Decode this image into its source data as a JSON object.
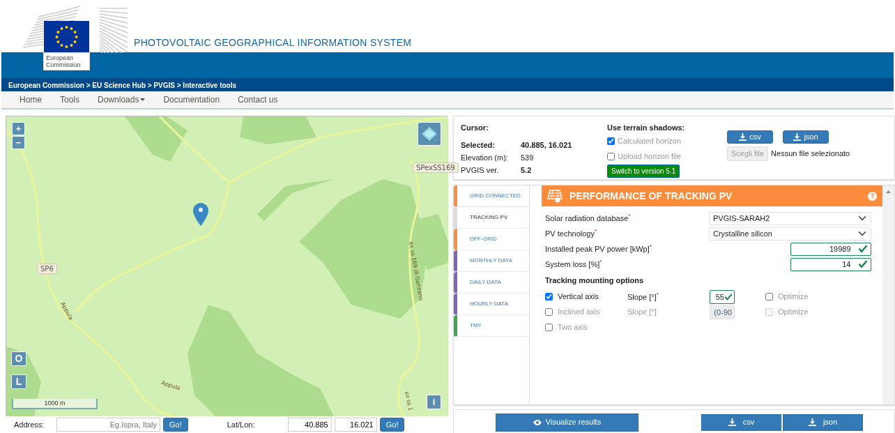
{
  "header": {
    "logo_lines": [
      "European",
      "Commission"
    ],
    "title": "PHOTOVOLTAIC GEOGRAPHICAL INFORMATION SYSTEM"
  },
  "breadcrumb": "European Commission > EU Science Hub > PVGIS > Interactive tools",
  "nav": [
    {
      "label": "Home",
      "dropdown": false
    },
    {
      "label": "Tools",
      "dropdown": false
    },
    {
      "label": "Downloads",
      "dropdown": true
    },
    {
      "label": "Documentation",
      "dropdown": false
    },
    {
      "label": "Contact us",
      "dropdown": false
    }
  ],
  "map": {
    "zoom_in": "+",
    "zoom_out": "−",
    "buttons": [
      "O",
      "L"
    ],
    "info": "i",
    "scale": "1000 m",
    "labels": [
      {
        "text": "SPexSS169",
        "kind": "shield"
      },
      {
        "text": "SP6",
        "kind": "shield"
      },
      {
        "text": "Appula",
        "kind": "road"
      },
      {
        "text": "Appula",
        "kind": "road"
      },
      {
        "text": "ex ss 169 di Genzano",
        "kind": "road"
      },
      {
        "text": "ex ss 1",
        "kind": "road"
      }
    ]
  },
  "address": {
    "label": "Address:",
    "placeholder": "Eg.Ispra, Italy",
    "button": "Go!"
  },
  "latlon": {
    "label": "Lat/Lon:",
    "lat": "40.885",
    "lon": "16.021",
    "button": "Go!"
  },
  "info": {
    "cursor": "Cursor:",
    "rows": [
      {
        "label": "Selected:",
        "value": "40.885, 16.021",
        "label_bold": true,
        "value_bold": true
      },
      {
        "label": "Elevation (m):",
        "value": "539",
        "label_bold": false,
        "value_bold": false
      },
      {
        "label": "PVGIS ver.",
        "value": "5.2",
        "label_bold": false,
        "value_bold": true
      }
    ]
  },
  "shadows": {
    "title": "Use terrain shadows:",
    "options": [
      {
        "label": "Calculated horizon",
        "checked": true
      },
      {
        "label": "Upload horizon file",
        "checked": false
      }
    ],
    "switch_button": "Switch to version 5.1"
  },
  "horizon_downloads": [
    "csv",
    "json"
  ],
  "file": {
    "button": "Scegli file",
    "status": "Nessun file selezionato"
  },
  "tabs": [
    {
      "label": "GRID CONNECTED",
      "color": "#f98e3b",
      "selected": false
    },
    {
      "label": "TRACKING PV",
      "color": "#dddddd",
      "selected": true
    },
    {
      "label": "OFF-GRID",
      "color": "#f98e3b",
      "selected": false
    },
    {
      "label": "MONTHLY DATA",
      "color": "#7f67b3",
      "selected": false
    },
    {
      "label": "DAILY DATA",
      "color": "#7f67b3",
      "selected": false
    },
    {
      "label": "HOURLY DATA",
      "color": "#7f67b3",
      "selected": false
    },
    {
      "label": "TMY",
      "color": "#3fa54a",
      "selected": false
    }
  ],
  "panel": {
    "title": "PERFORMANCE OF TRACKING PV",
    "help": "?",
    "fields": [
      {
        "kind": "select",
        "label": "Solar radiation database",
        "mark": "*",
        "value": "PVGIS-SARAH2"
      },
      {
        "kind": "select",
        "label": "PV technology",
        "mark": "*",
        "value": "Crystalline silicon"
      },
      {
        "kind": "input",
        "label": "Installed peak PV power [kWp]",
        "mark": "*",
        "value": "19989",
        "valid": true
      },
      {
        "kind": "input",
        "label": "System loss [%]",
        "mark": "*",
        "value": "14",
        "valid": true
      }
    ],
    "mounting_title": "Tracking mounting options",
    "mounting": [
      {
        "kind": "slope",
        "label": "Vertical axis",
        "checked": true,
        "disabled": false,
        "slope_label": "Slope [°]",
        "slope_mark": "*",
        "slope_value": "55",
        "optimize": "Optimize",
        "optimize_checked": false
      },
      {
        "kind": "slope",
        "label": "Inclined axis",
        "checked": false,
        "disabled": true,
        "slope_label": "Slope [°]",
        "slope_placeholder": "(0-90",
        "optimize": "Optimize",
        "optimize_checked": false
      },
      {
        "kind": "plain",
        "label": "Two axis",
        "checked": false,
        "disabled": true
      }
    ]
  },
  "actions": {
    "visualize": "Visualize results",
    "downloads": [
      "csv",
      "json"
    ]
  }
}
